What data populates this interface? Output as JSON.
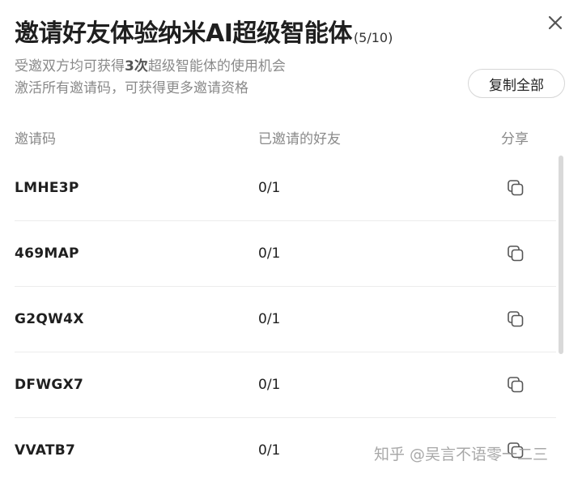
{
  "dialog": {
    "title": "邀请好友体验纳米AI超级智能体",
    "count": "(5/10)",
    "subtitle_prefix": "受邀双方均可获得",
    "subtitle_bold": "3次",
    "subtitle_suffix": "超级智能体的使用机会",
    "subtitle_line2": "激活所有邀请码，可获得更多邀请资格",
    "copy_all_label": "复制全部",
    "close_icon": "close-icon"
  },
  "table": {
    "headers": {
      "code": "邀请码",
      "friends": "已邀请的好友",
      "share": "分享"
    },
    "rows": [
      {
        "code": "LMHE3P",
        "count": "0/1"
      },
      {
        "code": "469MAP",
        "count": "0/1"
      },
      {
        "code": "G2QW4X",
        "count": "0/1"
      },
      {
        "code": "DFWGX7",
        "count": "0/1"
      },
      {
        "code": "VVATB7",
        "count": "0/1"
      }
    ],
    "share_icon": "copy-icon"
  },
  "watermark": "知乎 @吴言不语零一二三",
  "colors": {
    "text": "#1f1f1f",
    "muted": "#8a8a8a",
    "divider": "#ececec",
    "border": "#d6d6d6"
  }
}
